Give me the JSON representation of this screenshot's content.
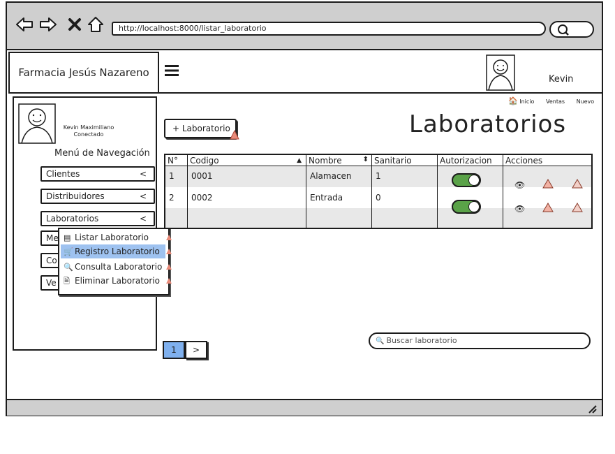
{
  "browser": {
    "url": "http://localhost:8000/listar_laboratorio"
  },
  "header": {
    "brand": "Farmacia Jesús Nazareno",
    "user_name": "Kevin"
  },
  "sidebar": {
    "profile_name": "Kevin Maximiliano",
    "profile_status": "Conectado",
    "menu_title": "Menú de Navegación",
    "items": [
      {
        "label": "Clientes",
        "chevron": "<"
      },
      {
        "label": "Distribuidores",
        "chevron": "<"
      },
      {
        "label": "Laboratorios",
        "chevron": "<"
      },
      {
        "label": "Me"
      },
      {
        "label": "Co"
      },
      {
        "label": "Ve"
      }
    ],
    "submenu": [
      {
        "icon": "list-icon",
        "label": "Listar Laboratorio"
      },
      {
        "icon": "cart-icon",
        "label": "Registro Laboratorio",
        "selected": true
      },
      {
        "icon": "search-icon",
        "label": "Consulta Laboratorio"
      },
      {
        "icon": "document-icon",
        "label": "Eliminar Laboratorio"
      }
    ]
  },
  "breadcrumb": {
    "home": "Inicio",
    "ventas": "Ventas",
    "nuevo": "Nuevo"
  },
  "main": {
    "title": "Laboratorios",
    "add_button": "+ Laboratorio"
  },
  "table": {
    "headers": [
      "N°",
      "Codigo",
      "Nombre",
      "Sanitario",
      "Autorizacion",
      "Acciones"
    ],
    "rows": [
      {
        "n": "1",
        "codigo": "0001",
        "nombre": "Alamacen",
        "sanitario": "1",
        "autorizacion": true
      },
      {
        "n": "2",
        "codigo": "0002",
        "nombre": "Entrada",
        "sanitario": "0",
        "autorizacion": true
      }
    ]
  },
  "pagination": {
    "current": "1",
    "next": ">"
  },
  "search": {
    "placeholder": "Buscar laboratorio"
  },
  "colors": {
    "toolbar": "#cfcfcf",
    "selected": "#9ec2f0",
    "toggle_on": "#5aa248",
    "row_shade": "#e8e8e8",
    "page_active": "#7fb0ee"
  }
}
